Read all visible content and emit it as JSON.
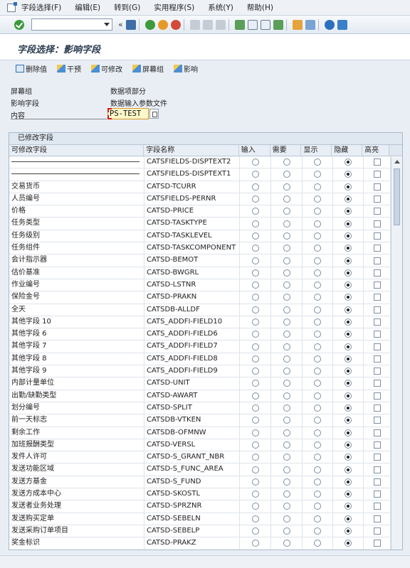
{
  "menu": [
    "字段选择(F)",
    "编辑(E)",
    "转到(G)",
    "实用程序(S)",
    "系统(Y)",
    "帮助(H)"
  ],
  "toolbar": {
    "command_value": "",
    "double_chevron": "«"
  },
  "title": "字段选择：影响字段",
  "app_toolbar": [
    "删除值",
    "干预",
    "可修改",
    "屏幕组",
    "影响"
  ],
  "form": {
    "labels": [
      "屏幕组",
      "影响字段",
      "内容"
    ],
    "screen_group": "数据项部分",
    "influence_field": "数据输入参数文件",
    "content": "PS-TEST"
  },
  "table": {
    "title": "已修改字段",
    "headers": [
      "可修改字段",
      "字段名称",
      "输入",
      "需要",
      "显示",
      "隐藏",
      "高亮"
    ],
    "rows": [
      {
        "label": "",
        "field": "CATSFIELDS-DISPTEXT2"
      },
      {
        "label": "",
        "field": "CATSFIELDS-DISPTEXT1"
      },
      {
        "label": "交易货币",
        "field": "CATSD-TCURR"
      },
      {
        "label": "人员编号",
        "field": "CATSFIELDS-PERNR"
      },
      {
        "label": "价格",
        "field": "CATSD-PRICE"
      },
      {
        "label": "任务类型",
        "field": "CATSD-TASKTYPE"
      },
      {
        "label": "任务级别",
        "field": "CATSD-TASKLEVEL"
      },
      {
        "label": "任务组件",
        "field": "CATSD-TASKCOMPONENT"
      },
      {
        "label": "会计指示器",
        "field": "CATSD-BEMOT"
      },
      {
        "label": "估价基准",
        "field": "CATSD-BWGRL"
      },
      {
        "label": "作业编号",
        "field": "CATSD-LSTNR"
      },
      {
        "label": "保险金号",
        "field": "CATSD-PRAKN"
      },
      {
        "label": "全天",
        "field": "CATSDB-ALLDF"
      },
      {
        "label": "其他字段 10",
        "field": "CATS_ADDFI-FIELD10"
      },
      {
        "label": "其他字段 6",
        "field": "CATS_ADDFI-FIELD6"
      },
      {
        "label": "其他字段 7",
        "field": "CATS_ADDFI-FIELD7"
      },
      {
        "label": "其他字段 8",
        "field": "CATS_ADDFI-FIELD8"
      },
      {
        "label": "其他字段 9",
        "field": "CATS_ADDFI-FIELD9"
      },
      {
        "label": "内部计量单位",
        "field": "CATSD-UNIT"
      },
      {
        "label": "出勤/缺勤类型",
        "field": "CATSD-AWART"
      },
      {
        "label": "划分编号",
        "field": "CATSD-SPLIT"
      },
      {
        "label": "前一天标志",
        "field": "CATSDB-VTKEN"
      },
      {
        "label": "剩余工作",
        "field": "CATSDB-OFMNW"
      },
      {
        "label": "加班报酬类型",
        "field": "CATSD-VERSL"
      },
      {
        "label": "发件人许可",
        "field": "CATSD-S_GRANT_NBR"
      },
      {
        "label": "发送功能区域",
        "field": "CATSD-S_FUNC_AREA"
      },
      {
        "label": "发送方基金",
        "field": "CATSD-S_FUND"
      },
      {
        "label": "发送方成本中心",
        "field": "CATSD-SKOSTL"
      },
      {
        "label": "发送者业务处理",
        "field": "CATSD-SPRZNR"
      },
      {
        "label": "发送购买定单",
        "field": "CATSD-SEBELN"
      },
      {
        "label": "发送采购订单项目",
        "field": "CATSD-SEBELP"
      },
      {
        "label": "奖金标识",
        "field": "CATSD-PRAKZ"
      }
    ]
  }
}
